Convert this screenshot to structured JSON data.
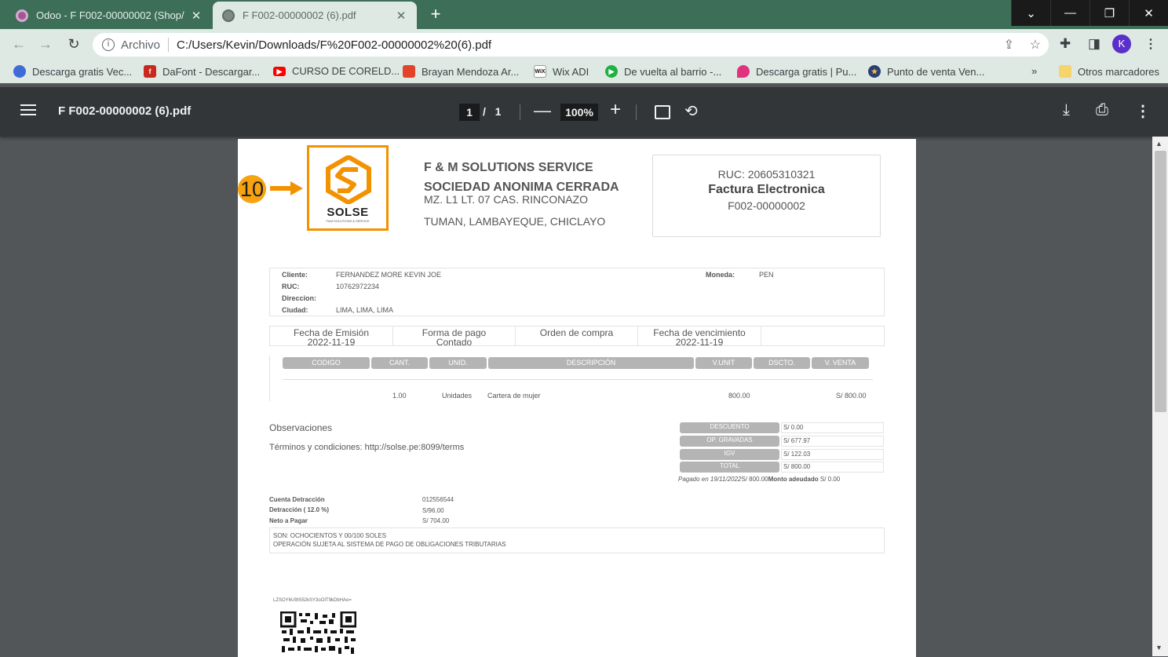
{
  "browser": {
    "tabs": [
      {
        "title": "Odoo - F F002-00000002 (Shop/",
        "active": false
      },
      {
        "title": "F F002-00000002 (6).pdf",
        "active": true
      }
    ],
    "address": {
      "scheme_label": "Archivo",
      "url": "C:/Users/Kevin/Downloads/F%20F002-00000002%20(6).pdf"
    },
    "profile_initial": "K",
    "bookmarks": [
      {
        "label": "Descarga gratis Vec...",
        "icon": "freepik-icon",
        "color": "#3f6ad8"
      },
      {
        "label": "DaFont - Descargar...",
        "icon": "dafont-icon",
        "color": "#c8281e"
      },
      {
        "label": "CURSO DE CORELD...",
        "icon": "youtube-icon",
        "color": "#ff0000"
      },
      {
        "label": "Brayan Mendoza Ar...",
        "icon": "gitlab-icon",
        "color": "#e24329"
      },
      {
        "label": "Wix ADI",
        "icon": "wix-icon",
        "color": "#111111"
      },
      {
        "label": "De vuelta al barrio -...",
        "icon": "play-icon",
        "color": "#1fb141"
      },
      {
        "label": "Descarga gratis | Pu...",
        "icon": "drop-icon",
        "color": "#e0337c"
      },
      {
        "label": "Punto de venta Ven...",
        "icon": "star-badge-icon",
        "color": "#2b3f73"
      }
    ],
    "bookmarks_more": "»",
    "other_bookmarks": "Otros marcadores"
  },
  "pdf_viewer": {
    "filename": "F F002-00000002 (6).pdf",
    "current_page": "1",
    "page_sep": "/",
    "total_pages": "1",
    "zoom": "100%"
  },
  "invoice": {
    "annotation_number": "10",
    "logo_text": "SOLSE",
    "logo_tagline": "F&M SOLUTIONS & SERVICE",
    "company_line1": "F & M SOLUTIONS SERVICE",
    "company_line2": "SOCIEDAD ANONIMA CERRADA",
    "address_line1": "MZ. L1 LT. 07 CAS. RINCONAZO",
    "address_line2": "TUMAN, LAMBAYEQUE, CHICLAYO",
    "ruc": "RUC: 20605310321",
    "doc_type": "Factura Electronica",
    "doc_number": "F002-00000002",
    "client": {
      "cliente_label": "Cliente:",
      "cliente": "FERNANDEZ MORE KEVIN JOE",
      "ruc_label": "RUC:",
      "ruc": "10762972234",
      "direccion_label": "Direccion:",
      "direccion": "",
      "ciudad_label": "Ciudad:",
      "ciudad": "LIMA, LIMA, LIMA",
      "moneda_label": "Moneda:",
      "moneda": "PEN"
    },
    "dates": [
      {
        "label": "Fecha de Emisión",
        "value": "2022-11-19"
      },
      {
        "label": "Forma de pago",
        "value": "Contado"
      },
      {
        "label": "Orden de compra",
        "value": ""
      },
      {
        "label": "Fecha de vencimiento",
        "value": "2022-11-19"
      },
      {
        "label": "",
        "value": ""
      }
    ],
    "item_headers": [
      "CODIGO",
      "CANT.",
      "UNID.",
      "DESCRIPCIÓN",
      "V.UNIT",
      "DSCTO.",
      "V. VENTA"
    ],
    "items": [
      {
        "cant": "1.00",
        "unid": "Unidades",
        "desc": "Cartera de mujer",
        "vunit": "800.00",
        "vventa": "S/ 800.00"
      }
    ],
    "observaciones": "Observaciones",
    "terms": "Términos y condiciones: http://solse.pe:8099/terms",
    "totals": [
      {
        "label": "DESCUENTO",
        "value": "S/ 0.00"
      },
      {
        "label": "OP. GRAVADAS",
        "value": "S/ 677.97"
      },
      {
        "label": "IGV",
        "value": "S/ 122.03"
      },
      {
        "label": "TOTAL",
        "value": "S/ 800.00"
      }
    ],
    "paid_text": "Pagado en 19/11/2022",
    "paid_amount": "S/ 800.00",
    "due_label": "Monto adeudado",
    "due_amount": "S/ 0.00",
    "detraccion": [
      {
        "label": "Cuenta Detracción",
        "value": "012556544"
      },
      {
        "label": "Detracción ( 12.0 %)",
        "value": "S/96.00"
      },
      {
        "label": "Neto a Pagar",
        "value": "S/ 704.00"
      }
    ],
    "son_label": "SON:",
    "son_text": "OCHOCIENTOS Y 00/100 SOLES",
    "operacion_text": "OPERACIÓN SUJETA AL SISTEMA DE PAGO DE OBLIGACIONES TRIBUTARIAS",
    "qr_hash": "LZSOY6U9tS52kSY3oOIT9kDbHAo="
  },
  "colors": {
    "accent_orange": "#f39200",
    "tab_strip": "#3c6e58",
    "viewer_bg": "#525659"
  }
}
